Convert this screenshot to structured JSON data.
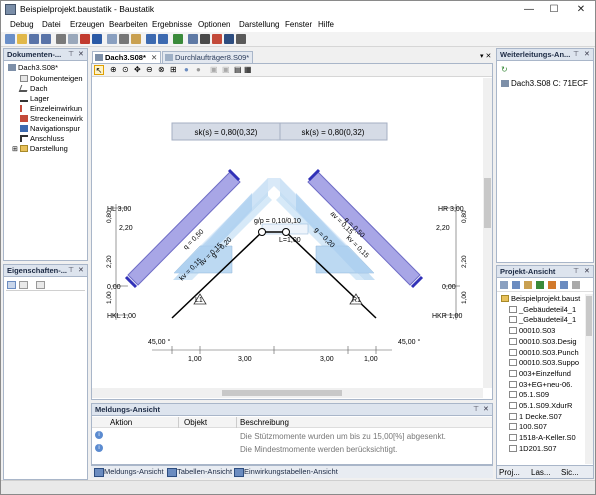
{
  "window": {
    "title": "Beispielprojekt.baustatik - Baustatik",
    "controls": [
      "—",
      "☐",
      "✕"
    ]
  },
  "menu": [
    "Debug",
    "Datei",
    "Erzeugen",
    "Bearbeiten",
    "Ergebnisse",
    "Optionen",
    "Darstellung",
    "Fenster",
    "Hilfe"
  ],
  "toolbar_icons": [
    {
      "name": "new-doc-icon",
      "color": "#6a8fc8"
    },
    {
      "name": "open-icon",
      "color": "#e1b84a"
    },
    {
      "name": "save-icon",
      "color": "#5a74a8"
    },
    {
      "name": "save-all-icon",
      "color": "#5a74a8"
    },
    {
      "name": "print-icon",
      "color": "#7a7a7a"
    },
    {
      "name": "preview-icon",
      "color": "#9aa8bb"
    },
    {
      "name": "pdf-icon",
      "color": "#c23b2f"
    },
    {
      "name": "word-icon",
      "color": "#2b5aa6"
    },
    {
      "name": "copy-icon",
      "color": "#8aa0c0"
    },
    {
      "name": "cut-icon",
      "color": "#777777"
    },
    {
      "name": "paste-icon",
      "color": "#c9a050"
    },
    {
      "name": "undo-icon",
      "color": "#3d6ab0"
    },
    {
      "name": "redo-icon",
      "color": "#3d6ab0"
    },
    {
      "name": "recalc-icon",
      "color": "#3a8a3a"
    },
    {
      "name": "ruler-icon",
      "color": "#5f7aa5"
    },
    {
      "name": "support-icon",
      "color": "#4a4a4a"
    },
    {
      "name": "load-icon",
      "color": "#c34a3a"
    },
    {
      "name": "function-icon",
      "color": "#2d4d80"
    },
    {
      "name": "help-icon",
      "color": "#5a5a5a"
    }
  ],
  "left_panel": {
    "title": "Dokumenten-...",
    "items": [
      {
        "label": "Dach3.S08*",
        "level": 0
      },
      {
        "label": "Dokumenteigen",
        "level": 1
      },
      {
        "label": "Dach",
        "level": 1
      },
      {
        "label": "Lager",
        "level": 1
      },
      {
        "label": "Einzeleinwirkun",
        "level": 1
      },
      {
        "label": "Streckeneinwirk",
        "level": 1
      },
      {
        "label": "Navigationspur",
        "level": 1
      },
      {
        "label": "Anschluss",
        "level": 1
      },
      {
        "label": "Darstellung",
        "level": 1
      }
    ]
  },
  "props_panel": {
    "title": "Eigenschaften-..."
  },
  "doc_tabs": [
    {
      "label": "Dach3.S08*",
      "active": true
    },
    {
      "label": "Durchlaufträger8.S09*",
      "active": false
    }
  ],
  "canvas": {
    "info_boxes": [
      "sk(s) = 0,80(0,32)",
      "sk(s) = 0,80(0,32)"
    ],
    "left_labels": {
      "top": "HL 3,00",
      "mid": "0,00",
      "bot": "HKL 1,00"
    },
    "right_labels": {
      "top": "HR 3,00",
      "mid": "0,00",
      "bot": "HKR 1,00"
    },
    "left_dims": [
      "0,80",
      "2,20",
      "2,20",
      "1,00"
    ],
    "right_dims": [
      "0,80",
      "2,20",
      "2,20",
      "1,00"
    ],
    "ridge_label": "g/p = 0,10/0,10",
    "ridge_len": "L=1,00",
    "load_labels_left": [
      "q = 0,50",
      "kv = 0,15",
      "av = 0,15",
      "g = 0,20"
    ],
    "load_labels_right": [
      "q = 0,50",
      "av = 0,15",
      "kv = 0,15",
      "g = 0,20"
    ],
    "angles": [
      "45,00 °",
      "45,00 °"
    ],
    "bottom_dims": [
      "1,00",
      "3,00",
      "3,00",
      "1,00"
    ],
    "support_labels": [
      "L1",
      "R1"
    ]
  },
  "right_panel": {
    "title": "Weiterleitungs-An...",
    "item": "Dach3.S08 C: 71ECF"
  },
  "project_panel": {
    "title": "Projekt-Ansicht",
    "items": [
      "Beispielprojekt.baust",
      "_Gebäudeteil4_1",
      "_Gebäudeteil4_1",
      "00010.S03",
      "00010.S03.Desig",
      "00010.S03.Punch",
      "00010.S03.Suppo",
      "003+Einzelfund",
      "03+EG+neu-06.",
      "05.1.S09",
      "05.1.S09.XdurR",
      "1 Decke.S07",
      "100.S07",
      "1518-A-Keller.S0",
      "1D201.S07"
    ],
    "tabs": [
      "Proj...",
      "Las...",
      "Sic..."
    ]
  },
  "messages": {
    "title": "Meldungs-Ansicht",
    "columns": [
      "Aktion",
      "Objekt",
      "Beschreibung"
    ],
    "rows": [
      {
        "description": "Die Stützmomente wurden um bis zu 15,00[%] abgesenkt."
      },
      {
        "description": "Die Mindestmomente werden berücksichtigt."
      }
    ]
  },
  "bottom_tabs": [
    "Meldungs-Ansicht",
    "Tabellen-Ansicht",
    "Einwirkungstabellen-Ansicht"
  ],
  "colors": {
    "accent": "#dde4ee",
    "load_purple": "#a8a6e6",
    "load_blue": "#bcd9f2",
    "frame": "#a9b6c9"
  }
}
